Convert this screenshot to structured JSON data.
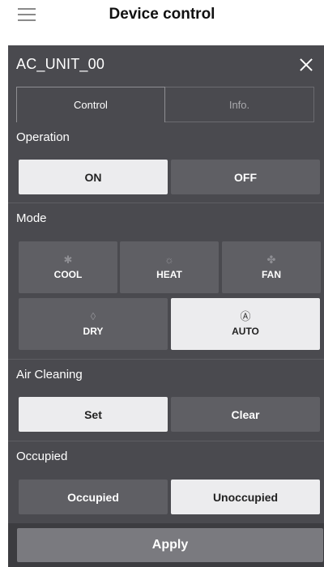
{
  "header": {
    "title": "Device control",
    "menu_icon": "hamburger-menu-icon"
  },
  "panel": {
    "unit_name": "AC_UNIT_00",
    "close_icon": "close-icon",
    "tabs": [
      {
        "label": "Control",
        "active": true
      },
      {
        "label": "Info.",
        "active": false
      }
    ]
  },
  "operation": {
    "label": "Operation",
    "options": [
      {
        "label": "ON",
        "selected": true
      },
      {
        "label": "OFF",
        "selected": false
      }
    ]
  },
  "mode": {
    "label": "Mode",
    "options": [
      {
        "label": "COOL",
        "icon": "snowflake-icon",
        "glyph": "✱",
        "selected": false
      },
      {
        "label": "HEAT",
        "icon": "sun-icon",
        "glyph": "☼",
        "selected": false
      },
      {
        "label": "FAN",
        "icon": "fan-icon",
        "glyph": "✤",
        "selected": false
      },
      {
        "label": "DRY",
        "icon": "droplet-icon",
        "glyph": "◊",
        "selected": false
      },
      {
        "label": "AUTO",
        "icon": "auto-mode-icon",
        "glyph": "Ⓐ",
        "selected": true
      }
    ]
  },
  "air_cleaning": {
    "label": "Air Cleaning",
    "options": [
      {
        "label": "Set",
        "selected": true
      },
      {
        "label": "Clear",
        "selected": false
      }
    ]
  },
  "occupied": {
    "label": "Occupied",
    "options": [
      {
        "label": "Occupied",
        "selected": false
      },
      {
        "label": "Unoccupied",
        "selected": true
      }
    ]
  },
  "apply_label": "Apply",
  "colors": {
    "panel_bg": "#4a4a4f",
    "button_bg": "#5f5f64",
    "selected_bg": "#ececee",
    "apply_bg": "#7a7a7f"
  }
}
